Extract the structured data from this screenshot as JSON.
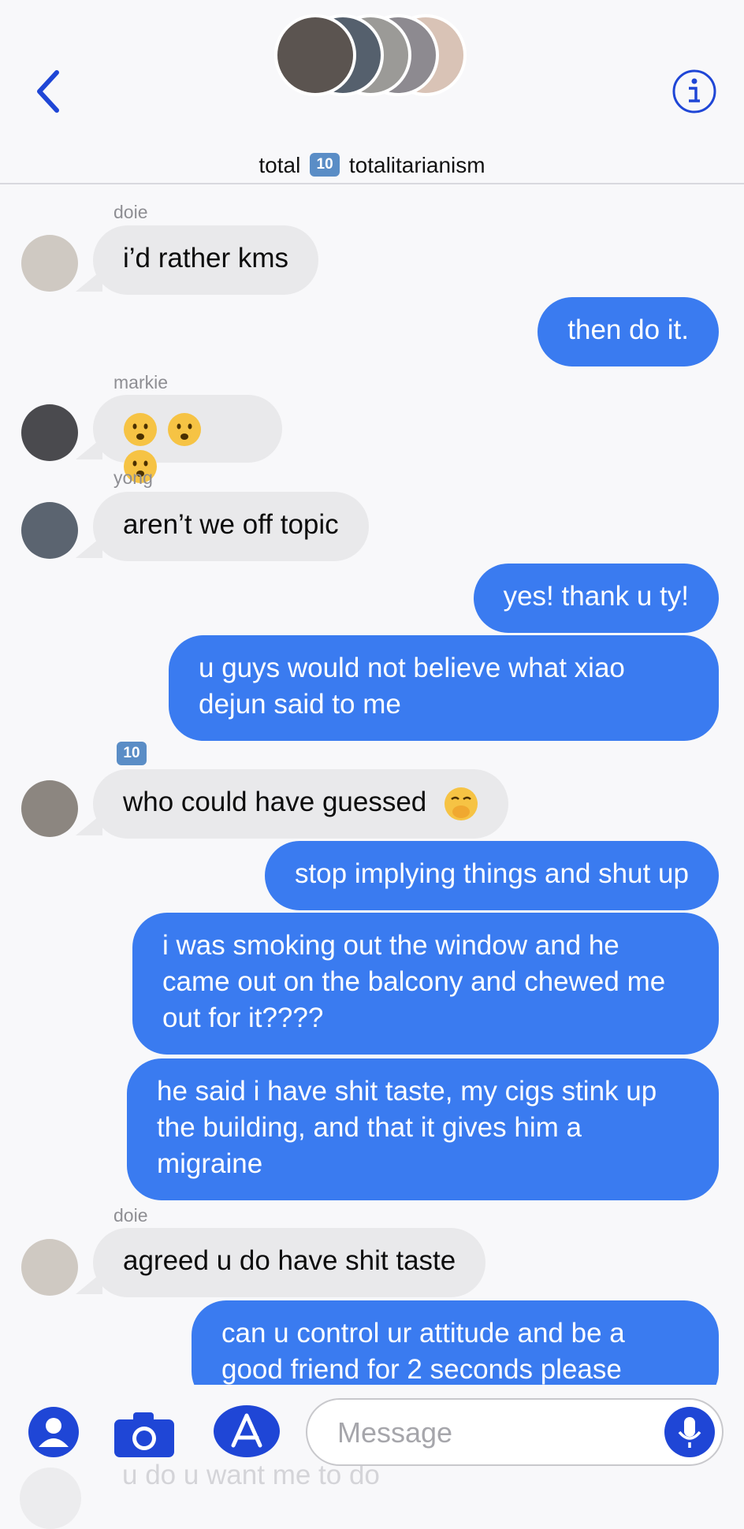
{
  "header": {
    "title_prefix": "total",
    "title_badge": "10",
    "title_suffix": "totalitarianism"
  },
  "messages": [
    {
      "sender": "doie",
      "text": "i’d rather kms",
      "dir": "in"
    },
    {
      "text": "then do it.",
      "dir": "out"
    },
    {
      "sender": "markie",
      "dir": "in",
      "emoji": "anguished-faces"
    },
    {
      "sender": "yong",
      "text": "aren’t we off topic",
      "dir": "in"
    },
    {
      "text": "yes! thank u ty!",
      "dir": "out"
    },
    {
      "text": "u guys would not believe what xiao dejun said to me",
      "dir": "out"
    },
    {
      "sender": "10",
      "text": "who could have guessed",
      "dir": "in",
      "emoji": "hand-over-mouth-face"
    },
    {
      "text": "stop implying things and shut up",
      "dir": "out"
    },
    {
      "text": "i was smoking out the window and he came out on the balcony and chewed me out for it????",
      "dir": "out"
    },
    {
      "text": "he said i have shit taste, my cigs stink up the building, and that it gives him a migraine",
      "dir": "out"
    },
    {
      "sender": "doie",
      "text": "agreed u do have shit taste",
      "dir": "in"
    },
    {
      "text": "can u control ur attitude and be a good friend for 2 seconds please",
      "dir": "out"
    }
  ],
  "peek": {
    "text": "u do u want me to do"
  },
  "composer": {
    "placeholder": "Message",
    "icons": [
      "contact-icon",
      "camera-icon",
      "app-store-icon",
      "microphone-icon"
    ]
  },
  "colors": {
    "outgoing": "#3a7bf0",
    "incoming": "#e9e9eb",
    "accent": "#1f46d6"
  }
}
